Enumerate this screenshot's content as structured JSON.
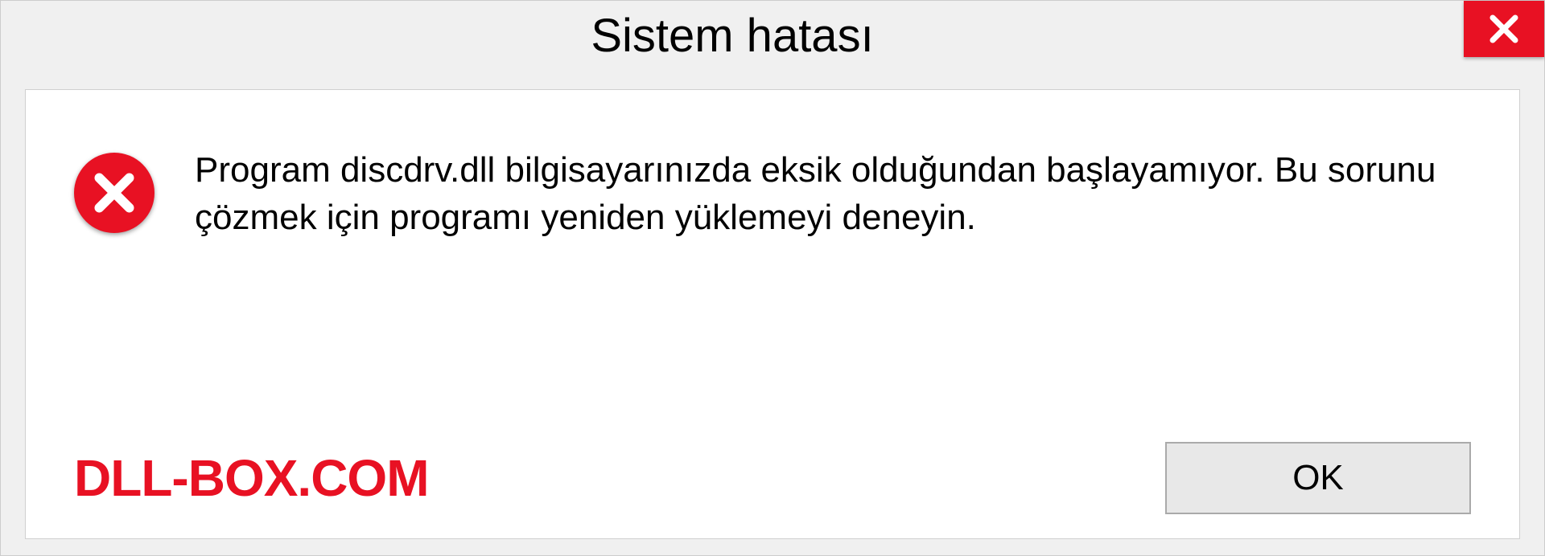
{
  "dialog": {
    "title": "Sistem hatası",
    "message": "Program discdrv.dll bilgisayarınızda eksik olduğundan başlayamıyor. Bu sorunu çözmek için programı yeniden yüklemeyi deneyin.",
    "ok_label": "OK"
  },
  "watermark": "DLL-BOX.COM",
  "colors": {
    "error_red": "#e81123",
    "panel_bg": "#f0f0f0"
  }
}
